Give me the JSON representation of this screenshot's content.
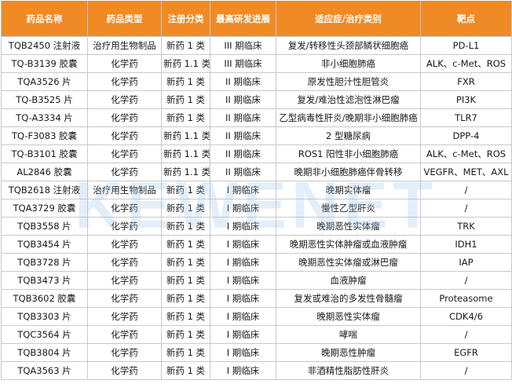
{
  "watermark": "KEWENET",
  "columns": [
    "药品名称",
    "药品类型",
    "注册分类",
    "最高研发进展",
    "适应症/治疗类别",
    "靶点"
  ],
  "rows": [
    [
      "TQB2450 注射液",
      "治疗用生物制品",
      "新药 1 类",
      "III 期临床",
      "复发/转移性头颈部鳞状细胞癌",
      "PD-L1"
    ],
    [
      "TQ-B3139 胶囊",
      "化学药",
      "新药 1.1 类",
      "III 期临床",
      "非小细胞肺癌",
      "ALK、c-Met、ROS"
    ],
    [
      "TQA3526 片",
      "化学药",
      "新药 1 类",
      "II 期临床",
      "原发性胆汁性胆管炎",
      "FXR"
    ],
    [
      "TQ-B3525 片",
      "化学药",
      "新药 1 类",
      "II 期临床",
      "复发/难治性滤泡性淋巴瘤",
      "PI3K"
    ],
    [
      "TQ-A3334 片",
      "化学药",
      "新药 1 类",
      "II 期临床",
      "乙型病毒性肝炎/晚期非小细胞肺癌",
      "TLR7"
    ],
    [
      "TQ-F3083 胶囊",
      "化学药",
      "新药 1.1 类",
      "II 期临床",
      "2 型糖尿病",
      "DPP-4"
    ],
    [
      "TQ-B3101 胶囊",
      "化学药",
      "新药 1.1 类",
      "II 期临床",
      "ROS1 阳性非小细胞肺癌",
      "ALK、c-Met、ROS"
    ],
    [
      "AL2846 胶囊",
      "化学药",
      "新药 1.1 类",
      "II 期临床",
      "晚期非小细胞肺癌伴骨转移",
      "VEGFR、MET、AXL"
    ],
    [
      "TQB2618 注射液",
      "治疗用生物制品",
      "新药 1 类",
      "I 期临床",
      "晚期实体瘤",
      "/"
    ],
    [
      "TQA3729 胶囊",
      "化学药",
      "新药 1 类",
      "I 期临床",
      "慢性乙型肝炎",
      "/"
    ],
    [
      "TQB3558 片",
      "化学药",
      "新药 1 类",
      "I 期临床",
      "晚期恶性实体瘤",
      "TRK"
    ],
    [
      "TQB3454 片",
      "化学药",
      "新药 1 类",
      "I 期临床",
      "晚期恶性实体肿瘤或血液肿瘤",
      "IDH1"
    ],
    [
      "TQB3728 片",
      "化学药",
      "新药 1 类",
      "I 期临床",
      "晚期恶性实体瘤或淋巴瘤",
      "IAP"
    ],
    [
      "TQB3473 片",
      "化学药",
      "新药 1 类",
      "I 期临床",
      "血液肿瘤",
      "/"
    ],
    [
      "TQB3602 胶囊",
      "化学药",
      "新药 1 类",
      "I 期临床",
      "复发或难治的多发性骨髓瘤",
      "Proteasome"
    ],
    [
      "TQB3303 片",
      "化学药",
      "新药 1 类",
      "I 期临床",
      "晚期恶性实体瘤",
      "CDK4/6"
    ],
    [
      "TQC3564 片",
      "化学药",
      "新药 1 类",
      "I 期临床",
      "哮喘",
      "/"
    ],
    [
      "TQB3804 片",
      "化学药",
      "新药 1 类",
      "I 期临床",
      "晚期恶性肿瘤",
      "EGFR"
    ],
    [
      "TQA3563 片",
      "化学药",
      "新药 1 类",
      "I 期临床",
      "非酒精性脂肪性肝炎",
      "/"
    ]
  ]
}
